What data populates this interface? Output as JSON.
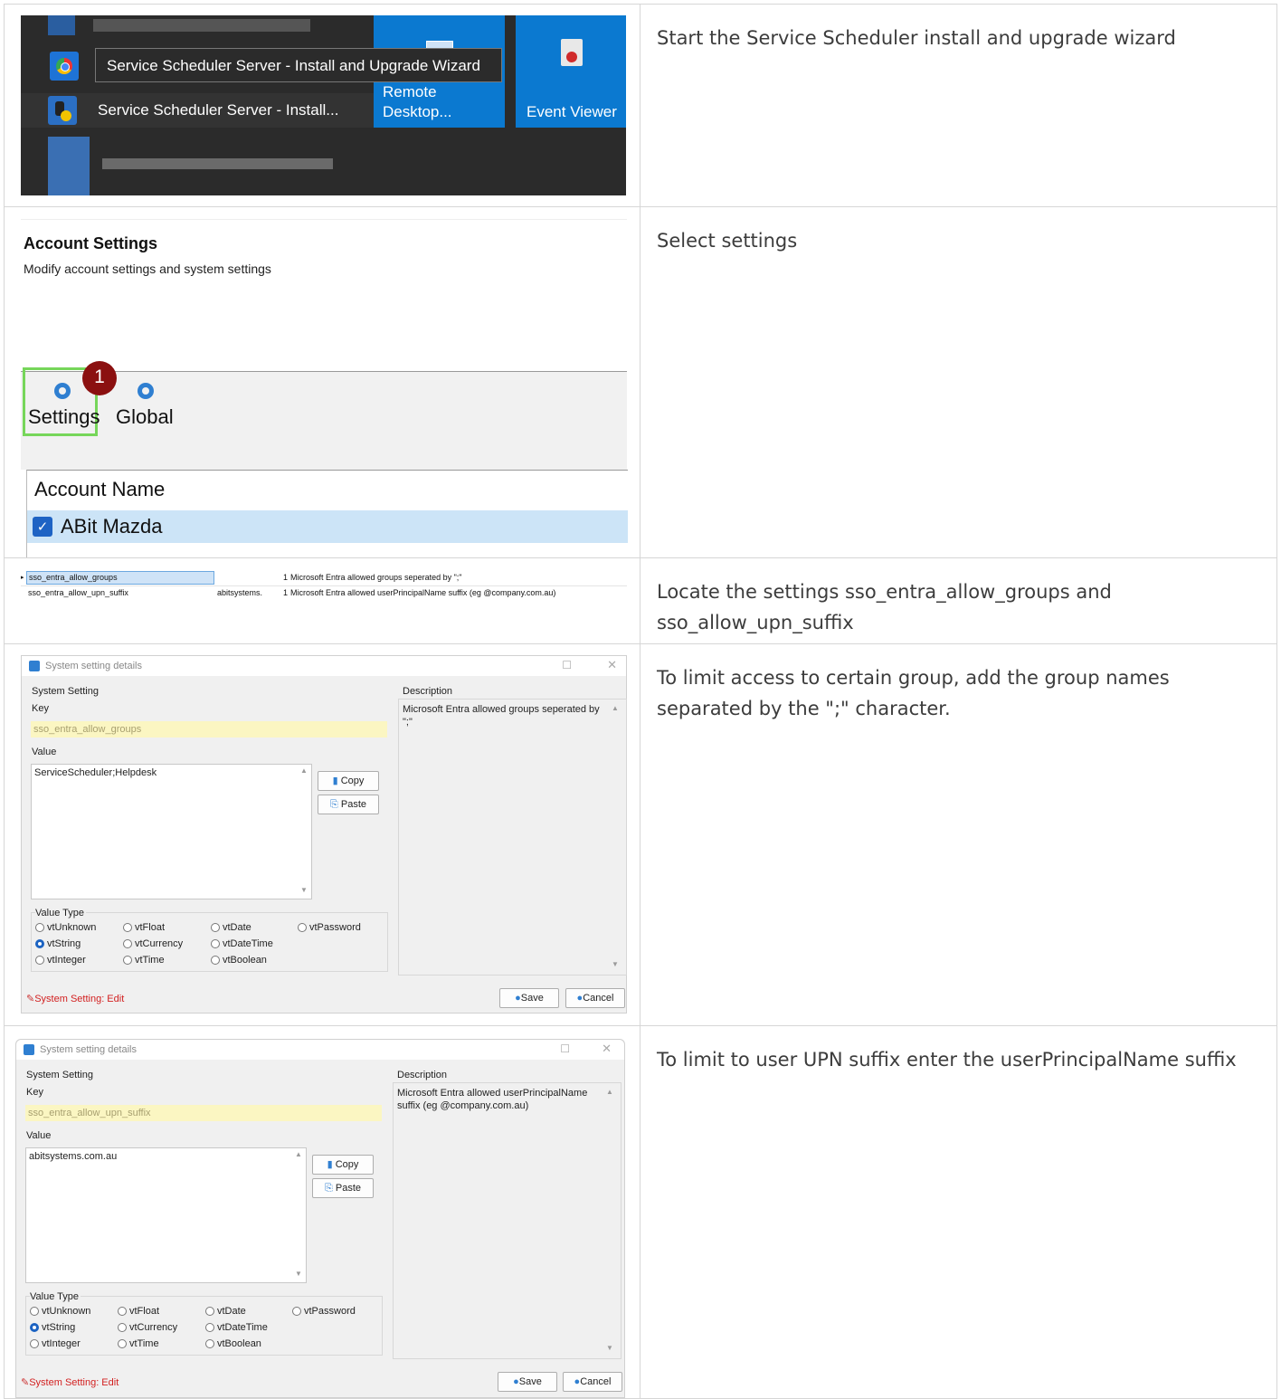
{
  "rows": [
    {
      "text": "Start the Service Scheduler install and upgrade wizard"
    },
    {
      "text": "Select settings"
    },
    {
      "text": "Locate the settings sso_entra_allow_groups and sso_allow_upn_suffix"
    },
    {
      "text": "To limit access to certain group, add the group names separated by the \";\" character."
    },
    {
      "text": "To limit to user UPN suffix enter the userPrincipalName suffix"
    }
  ],
  "startmenu": {
    "tooltip": "Service Scheduler Server - Install and Upgrade Wizard",
    "app_label": "Service Scheduler Server - Install...",
    "tile_remote": "Remote Desktop...",
    "tile_remote_l1": "Remote",
    "tile_remote_l2": "Desktop...",
    "tile_event": "Event Viewer",
    "colors": {
      "tile": "#0b79d0",
      "bg": "#2b2b2b"
    }
  },
  "account": {
    "title": "Account Settings",
    "subtitle": "Modify account settings and system settings",
    "btn_settings": "Settings",
    "btn_global": "Global",
    "step_badge": "1",
    "column_header": "Account Name",
    "account_row": "ABit Mazda"
  },
  "settings_list": [
    {
      "key": "sso_entra_allow_groups",
      "value": "",
      "num": "1",
      "desc": "Microsoft Entra allowed groups seperated by \";\""
    },
    {
      "key": "sso_entra_allow_upn_suffix",
      "value": "abitsystems.",
      "num": "1",
      "desc": "Microsoft Entra allowed userPrincipalName suffix (eg @company.com.au)"
    }
  ],
  "dialog1": {
    "title": "System setting details",
    "group_label": "System Setting",
    "key_label": "Key",
    "key": "sso_entra_allow_groups",
    "value_label": "Value",
    "value": "ServiceScheduler;Helpdesk",
    "copy": "Copy",
    "paste": "Paste",
    "desc_label": "Description",
    "desc": "Microsoft Entra allowed groups seperated by \";\"",
    "value_type_label": "Value Type",
    "types": [
      "vtUnknown",
      "vtFloat",
      "vtDate",
      "vtPassword",
      "vtString",
      "vtCurrency",
      "vtDateTime",
      "vtInteger",
      "vtTime",
      "vtBoolean"
    ],
    "selected_type": "vtString",
    "status": "System Setting: Edit",
    "save": "Save",
    "cancel": "Cancel"
  },
  "dialog2": {
    "title": "System setting details",
    "group_label": "System Setting",
    "key_label": "Key",
    "key": "sso_entra_allow_upn_suffix",
    "value_label": "Value",
    "value": "abitsystems.com.au",
    "copy": "Copy",
    "paste": "Paste",
    "desc_label": "Description",
    "desc": "Microsoft Entra allowed userPrincipalName suffix (eg @company.com.au)",
    "value_type_label": "Value Type",
    "types": [
      "vtUnknown",
      "vtFloat",
      "vtDate",
      "vtPassword",
      "vtString",
      "vtCurrency",
      "vtDateTime",
      "vtInteger",
      "vtTime",
      "vtBoolean"
    ],
    "selected_type": "vtString",
    "status": "System Setting: Edit",
    "save": "Save",
    "cancel": "Cancel"
  }
}
